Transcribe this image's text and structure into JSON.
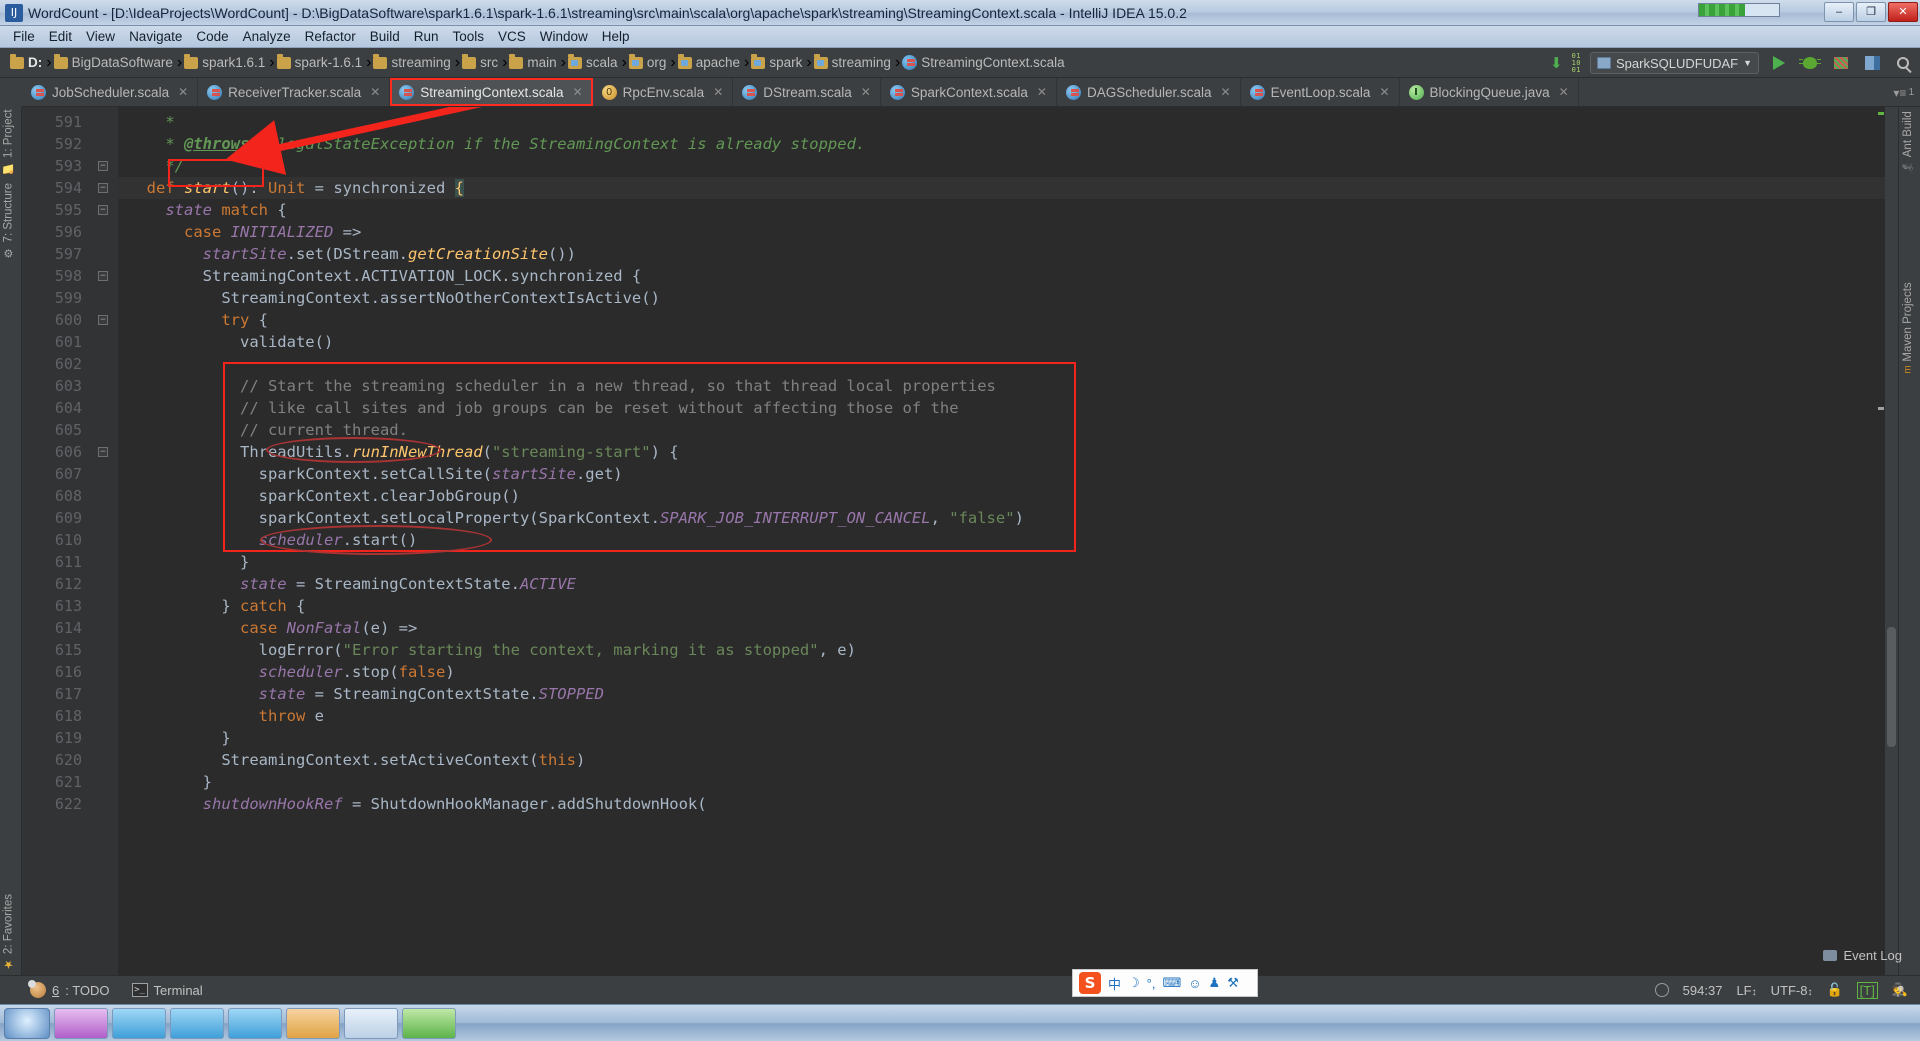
{
  "window": {
    "icon": "intellij-icon",
    "title": "WordCount - [D:\\IdeaProjects\\WordCount] - D:\\BigDataSoftware\\spark1.6.1\\spark-1.6.1\\streaming\\src\\main\\scala\\org\\apache\\spark\\streaming\\StreamingContext.scala - IntelliJ IDEA 15.0.2",
    "minimize": "–",
    "maximize": "❐",
    "close": "✕"
  },
  "menubar": {
    "items": [
      "File",
      "Edit",
      "View",
      "Navigate",
      "Code",
      "Analyze",
      "Refactor",
      "Build",
      "Run",
      "Tools",
      "VCS",
      "Window",
      "Help"
    ]
  },
  "navbar": {
    "crumbs": [
      {
        "label": "D:",
        "icon": "folder-icon",
        "bold": true
      },
      {
        "label": "BigDataSoftware",
        "icon": "folder-icon",
        "bold": false
      },
      {
        "label": "spark1.6.1",
        "icon": "folder-icon",
        "bold": false
      },
      {
        "label": "spark-1.6.1",
        "icon": "folder-icon",
        "bold": false
      },
      {
        "label": "streaming",
        "icon": "folder-icon",
        "bold": false
      },
      {
        "label": "src",
        "icon": "folder-icon",
        "bold": false
      },
      {
        "label": "main",
        "icon": "folder-icon",
        "bold": false
      },
      {
        "label": "scala",
        "icon": "source-folder-icon",
        "bold": false
      },
      {
        "label": "org",
        "icon": "source-folder-icon",
        "bold": false
      },
      {
        "label": "apache",
        "icon": "source-folder-icon",
        "bold": false
      },
      {
        "label": "spark",
        "icon": "source-folder-icon",
        "bold": false
      },
      {
        "label": "streaming",
        "icon": "source-folder-icon",
        "bold": false
      },
      {
        "label": "StreamingContext.scala",
        "icon": "scala-file-icon",
        "bold": false
      }
    ],
    "separator": "›",
    "run_config": "SparkSQLUDFUDAF",
    "dropdown_arrow": "▼",
    "buttons": [
      "run-button",
      "debug-button",
      "coverage-button",
      "build-button",
      "search-button"
    ]
  },
  "tabs": [
    {
      "label": "JobScheduler.scala",
      "icon": "scala-file-icon",
      "active": false,
      "highlighted": false
    },
    {
      "label": "ReceiverTracker.scala",
      "icon": "scala-file-icon",
      "active": false,
      "highlighted": false
    },
    {
      "label": "StreamingContext.scala",
      "icon": "scala-file-icon",
      "active": true,
      "highlighted": true
    },
    {
      "label": "RpcEnv.scala",
      "icon": "scala-object-icon",
      "active": false,
      "highlighted": false
    },
    {
      "label": "DStream.scala",
      "icon": "scala-file-icon",
      "active": false,
      "highlighted": false
    },
    {
      "label": "SparkContext.scala",
      "icon": "scala-file-icon",
      "active": false,
      "highlighted": false
    },
    {
      "label": "DAGScheduler.scala",
      "icon": "scala-file-icon",
      "active": false,
      "highlighted": false
    },
    {
      "label": "EventLoop.scala",
      "icon": "scala-file-icon",
      "active": false,
      "highlighted": false
    },
    {
      "label": "BlockingQueue.java",
      "icon": "java-interface-icon",
      "active": false,
      "highlighted": false
    }
  ],
  "tab_close_glyph": "✕",
  "left_tool_strip": [
    {
      "label": "1: Project",
      "icon": "project-icon"
    },
    {
      "label": "7: Structure",
      "icon": "structure-icon"
    },
    {
      "label": "2: Favorites",
      "icon": "favorites-star-icon"
    }
  ],
  "right_tool_strip": [
    {
      "label": "Ant Build",
      "icon": "ant-icon"
    },
    {
      "label": "Maven Projects",
      "icon": "maven-icon"
    }
  ],
  "editor": {
    "first_line_number": 591,
    "current_line": 594,
    "lines": [
      {
        "n": 591,
        "fold": false,
        "html": "    <span class='doc'>*</span>"
      },
      {
        "n": 592,
        "fold": false,
        "html": "    <span class='doc'>* </span><span class='doctag'>@throws</span><span class='doc'> IllegalStateException if the StreamingContext is already stopped.</span>"
      },
      {
        "n": 593,
        "fold": true,
        "html": "    <span class='doc'>*/</span>"
      },
      {
        "n": 594,
        "fold": true,
        "cur": true,
        "html": "  <span class='kw'>def </span><span class='mth'>start</span><span class='id'>(): </span><span class='kw'>Unit</span><span class='id'> = synchronized </span><span class='brace-hl'>{</span>"
      },
      {
        "n": 595,
        "fold": true,
        "html": "    <span class='fld'>state</span><span class='id'> </span><span class='kw'>match</span><span class='id'> {</span>"
      },
      {
        "n": 596,
        "fold": false,
        "html": "      <span class='kw'>case </span><span class='fld'>INITIALIZED</span><span class='id'> =&gt;</span>"
      },
      {
        "n": 597,
        "fold": false,
        "html": "        <span class='fld'>startSite</span><span class='id'>.set(DStream.</span><span class='mth'>getCreationSite</span><span class='id'>())</span>"
      },
      {
        "n": 598,
        "fold": true,
        "html": "        <span class='id'>StreamingContext.ACTIVATION_LOCK.synchronized {</span>"
      },
      {
        "n": 599,
        "fold": false,
        "html": "          <span class='id'>StreamingContext.assertNoOtherContextIsActive()</span>"
      },
      {
        "n": 600,
        "fold": true,
        "html": "          <span class='kw'>try</span><span class='id'> {</span>"
      },
      {
        "n": 601,
        "fold": false,
        "html": "            <span class='id'>validate()</span>"
      },
      {
        "n": 602,
        "fold": false,
        "html": ""
      },
      {
        "n": 603,
        "fold": false,
        "html": "            <span class='cmt'>// Start the streaming scheduler in a new thread, so that thread local properties</span>"
      },
      {
        "n": 604,
        "fold": false,
        "html": "            <span class='cmt'>// like call sites and job groups can be reset without affecting those of the</span>"
      },
      {
        "n": 605,
        "fold": false,
        "html": "            <span class='cmt'>// current thread.</span>"
      },
      {
        "n": 606,
        "fold": true,
        "html": "            <span class='id'>ThreadUtils.</span><span class='mth'>runInNewThread</span><span class='id'>(</span><span class='str'>\"streaming-start\"</span><span class='id'>) {</span>"
      },
      {
        "n": 607,
        "fold": false,
        "html": "              <span class='id'>sparkContext.setCallSite(</span><span class='fld'>startSite</span><span class='id'>.get)</span>"
      },
      {
        "n": 608,
        "fold": false,
        "html": "              <span class='id'>sparkContext.clearJobGroup()</span>"
      },
      {
        "n": 609,
        "fold": false,
        "html": "              <span class='id'>sparkContext.setLocalProperty(SparkContext.</span><span class='fld'>SPARK_JOB_INTERRUPT_ON_CANCEL</span><span class='id'>, </span><span class='str'>\"false\"</span><span class='id'>)</span>"
      },
      {
        "n": 610,
        "fold": false,
        "html": "              <span class='fld'>scheduler</span><span class='id'>.start()</span>"
      },
      {
        "n": 611,
        "fold": false,
        "html": "            <span class='id'>}</span>"
      },
      {
        "n": 612,
        "fold": false,
        "html": "            <span class='fld'>state</span><span class='id'> = StreamingContextState.</span><span class='fld'>ACTIVE</span>"
      },
      {
        "n": 613,
        "fold": false,
        "html": "          <span class='id'>} </span><span class='kw'>catch</span><span class='id'> {</span>"
      },
      {
        "n": 614,
        "fold": false,
        "html": "            <span class='kw'>case </span><span class='fld'>NonFatal</span><span class='id'>(e) =&gt;</span>"
      },
      {
        "n": 615,
        "fold": false,
        "html": "              <span class='id'>logError(</span><span class='str'>\"Error starting the context, marking it as stopped\"</span><span class='id'>, e)</span>"
      },
      {
        "n": 616,
        "fold": false,
        "html": "              <span class='fld'>scheduler</span><span class='id'>.stop(</span><span class='kw'>false</span><span class='id'>)</span>"
      },
      {
        "n": 617,
        "fold": false,
        "html": "              <span class='fld'>state</span><span class='id'> = StreamingContextState.</span><span class='fld'>STOPPED</span>"
      },
      {
        "n": 618,
        "fold": false,
        "html": "              <span class='kw'>throw</span><span class='id'> e</span>"
      },
      {
        "n": 619,
        "fold": false,
        "html": "          <span class='id'>}</span>"
      },
      {
        "n": 620,
        "fold": false,
        "html": "          <span class='id'>StreamingContext.setActiveContext(</span><span class='kw'>this</span><span class='id'>)</span>"
      },
      {
        "n": 621,
        "fold": false,
        "html": "        <span class='id'>}</span>"
      },
      {
        "n": 622,
        "fold": false,
        "html": "        <span class='fld'>shutdownHookRef</span><span class='id'> = ShutdownHookManager.addShutdownHook(</span>"
      }
    ]
  },
  "annotations": {
    "color": "#f3241c",
    "ellipse_color": "#a33333",
    "tab_box": "StreamingContext.scala",
    "method_box": "start()",
    "code_block_box": "lines 603-611",
    "ellipse_1": "runInNewThread",
    "ellipse_2": "scheduler.start()",
    "arrow": "points from tab to start() method"
  },
  "bottom_bar": {
    "todo": {
      "num": "6",
      "label": ": TODO",
      "icon": "todo-icon"
    },
    "terminal": {
      "label": "Terminal",
      "icon": "terminal-icon"
    },
    "event_log": {
      "label": "Event Log",
      "icon": "event-log-icon"
    },
    "caret_position": "594:37",
    "line_separator": "LF",
    "encoding": "UTF-8",
    "lock_icon": "unlocked-icon",
    "ide_mode": "[T]",
    "hector_icon": "hector-icon",
    "separator_arrow": "↕"
  },
  "ime_bar": {
    "logo": "sogou-logo",
    "items": [
      "中",
      "☽",
      "°,",
      "⌨",
      "☺",
      "♟",
      "⚒"
    ]
  },
  "taskbar": {
    "start": "start-button",
    "buttons": [
      "task-1",
      "task-2",
      "task-3",
      "task-4",
      "task-5",
      "task-6",
      "task-7"
    ]
  }
}
